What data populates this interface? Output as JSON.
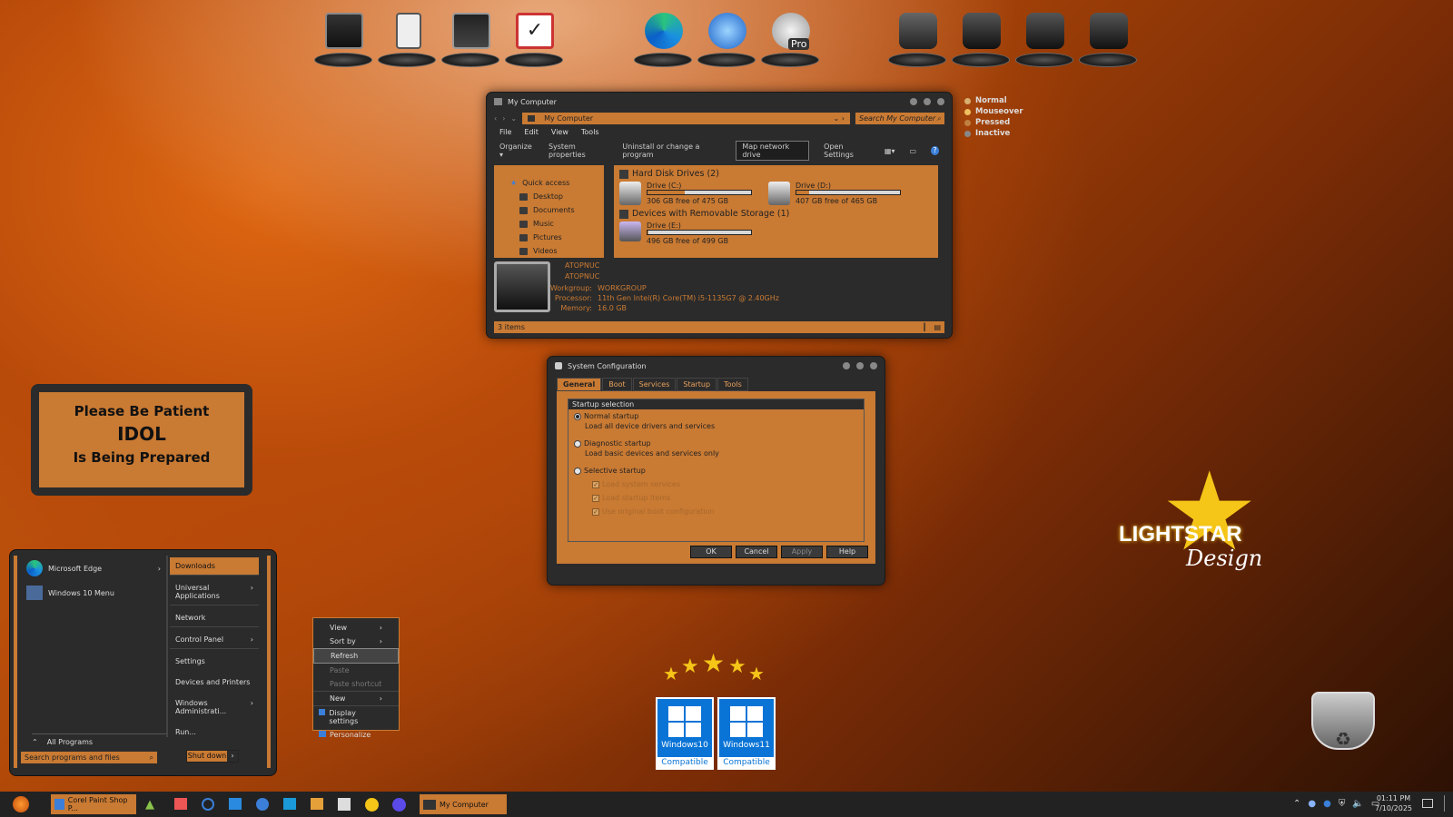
{
  "colors": {
    "accent": "#c97a33",
    "dark": "#2b2b2b",
    "text_light": "#dddddd"
  },
  "dock": {
    "items": [
      "monitor-icon",
      "clipboard-icon",
      "satellite-monitor-icon",
      "checklist-icon",
      "edge-icon",
      "thunderbird-icon",
      "google-earth-pro-icon",
      "camera-drive-icon",
      "drive-icon",
      "drive-icon",
      "drive-icon"
    ],
    "earth_pro_label": "Pro"
  },
  "legend": {
    "items": [
      "Normal",
      "Mouseover",
      "Pressed",
      "Inactive"
    ]
  },
  "explorer": {
    "title": "My Computer",
    "address": "My Computer",
    "search_placeholder": "Search My Computer",
    "menu": [
      "File",
      "Edit",
      "View",
      "Tools"
    ],
    "commands": [
      "Organize",
      "System properties",
      "Uninstall or change a program",
      "Map network drive",
      "Open Settings"
    ],
    "nav": [
      "Quick access",
      "Desktop",
      "Documents",
      "Music",
      "Pictures",
      "Videos"
    ],
    "groups": {
      "hdd": "Hard Disk Drives (2)",
      "removable": "Devices with Removable Storage (1)"
    },
    "drives": [
      {
        "name": "Drive (C:)",
        "free": "306 GB free of 475 GB",
        "used_fraction": 0.36
      },
      {
        "name": "Drive (D:)",
        "free": "407 GB free of 465 GB",
        "used_fraction": 0.12
      },
      {
        "name": "Drive (E:)",
        "free": "496 GB free of 499 GB",
        "used_fraction": 0.01
      }
    ],
    "details": {
      "name1": "ATOPNUC",
      "name2": "ATOPNUC",
      "rows": [
        {
          "k": "Workgroup:",
          "v": "WORKGROUP"
        },
        {
          "k": "Processor:",
          "v": "11th Gen Intel(R) Core(TM) i5-1135G7 @ 2.40GHz"
        },
        {
          "k": "Memory:",
          "v": "16.0 GB"
        }
      ]
    },
    "status": "3 items"
  },
  "sysconfig": {
    "title": "System Configuration",
    "tabs": [
      "General",
      "Boot",
      "Services",
      "Startup",
      "Tools"
    ],
    "section": "Startup selection",
    "normal": "Normal startup",
    "normal_desc": "Load all device drivers and services",
    "diag": "Diagnostic startup",
    "diag_desc": "Load basic devices and services only",
    "selective": "Selective startup",
    "checks": [
      "Load system services",
      "Load startup items",
      "Use original boot configuration"
    ],
    "buttons": [
      "OK",
      "Cancel",
      "Apply",
      "Help"
    ]
  },
  "patient": {
    "line1": "Please Be Patient",
    "line2": "IDOL",
    "line3": "Is Being Prepared"
  },
  "startmenu": {
    "left": [
      "Microsoft Edge",
      "Windows 10 Menu"
    ],
    "all_programs": "All Programs",
    "search_placeholder": "Search programs and files",
    "right": [
      "Downloads",
      "Universal Applications",
      "Network",
      "Control Panel",
      "Settings",
      "Devices and Printers",
      "Windows Administrati...",
      "Run..."
    ],
    "shutdown": "Shut down"
  },
  "context": {
    "items": [
      "View",
      "Sort by",
      "Refresh",
      "Paste",
      "Paste shortcut",
      "New",
      "Display settings",
      "Personalize"
    ]
  },
  "badges": [
    {
      "name": "Windows10",
      "label": "Compatible"
    },
    {
      "name": "Windows11",
      "label": "Compatible"
    }
  ],
  "rating": {
    "value": 5,
    "max": 5
  },
  "logo": {
    "line1": "LIGHTSTAR",
    "line2": "Design"
  },
  "taskbar": {
    "apps": [
      "Corel Paint Shop P...",
      "My Computer"
    ],
    "time": "01:11 PM",
    "date": "7/10/2025"
  }
}
